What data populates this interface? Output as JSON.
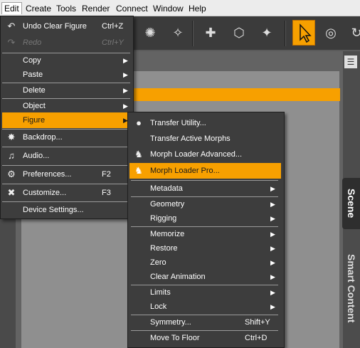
{
  "menubar": {
    "items": [
      "Edit",
      "Create",
      "Tools",
      "Render",
      "Connect",
      "Window",
      "Help"
    ],
    "active": "Edit"
  },
  "edit_menu": {
    "items": [
      {
        "label": "Undo Clear Figure",
        "shortcut": "Ctrl+Z",
        "icon": "undo-icon"
      },
      {
        "label": "Redo",
        "shortcut": "Ctrl+Y",
        "icon": "redo-icon",
        "disabled": true
      },
      {
        "label": "Copy",
        "submenu": true
      },
      {
        "label": "Paste",
        "submenu": true
      },
      {
        "label": "Delete",
        "submenu": true
      },
      {
        "label": "Object",
        "submenu": true
      },
      {
        "label": "Figure",
        "submenu": true,
        "highlighted": true
      },
      {
        "label": "Backdrop...",
        "icon": "backdrop-icon"
      },
      {
        "label": "Audio...",
        "icon": "audio-icon"
      },
      {
        "label": "Preferences...",
        "shortcut": "F2",
        "icon": "preferences-icon"
      },
      {
        "label": "Customize...",
        "shortcut": "F3",
        "icon": "customize-icon"
      },
      {
        "label": "Device Settings..."
      }
    ]
  },
  "figure_menu": {
    "items": [
      {
        "label": "Transfer Utility...",
        "icon": "transfer-utility-icon"
      },
      {
        "label": "Transfer Active Morphs"
      },
      {
        "label": "Morph Loader Advanced...",
        "icon": "morph-loader-icon"
      },
      {
        "label": "Morph Loader Pro...",
        "icon": "morph-loader-pro-icon",
        "highlighted": true
      },
      {
        "label": "Metadata",
        "submenu": true
      },
      {
        "label": "Geometry",
        "submenu": true
      },
      {
        "label": "Rigging",
        "submenu": true
      },
      {
        "label": "Memorize",
        "submenu": true
      },
      {
        "label": "Restore",
        "submenu": true
      },
      {
        "label": "Zero",
        "submenu": true
      },
      {
        "label": "Clear Animation",
        "submenu": true
      },
      {
        "label": "Limits",
        "submenu": true
      },
      {
        "label": "Lock",
        "submenu": true
      },
      {
        "label": "Symmetry...",
        "shortcut": "Shift+Y"
      },
      {
        "label": "Move To Floor",
        "shortcut": "Ctrl+D"
      }
    ]
  },
  "side_tabs": {
    "scene": "Scene",
    "smart_content": "Smart Content"
  },
  "colors": {
    "accent": "#f7a000",
    "menu_bg": "#3d3d3d",
    "menubar_bg": "#ececec"
  }
}
